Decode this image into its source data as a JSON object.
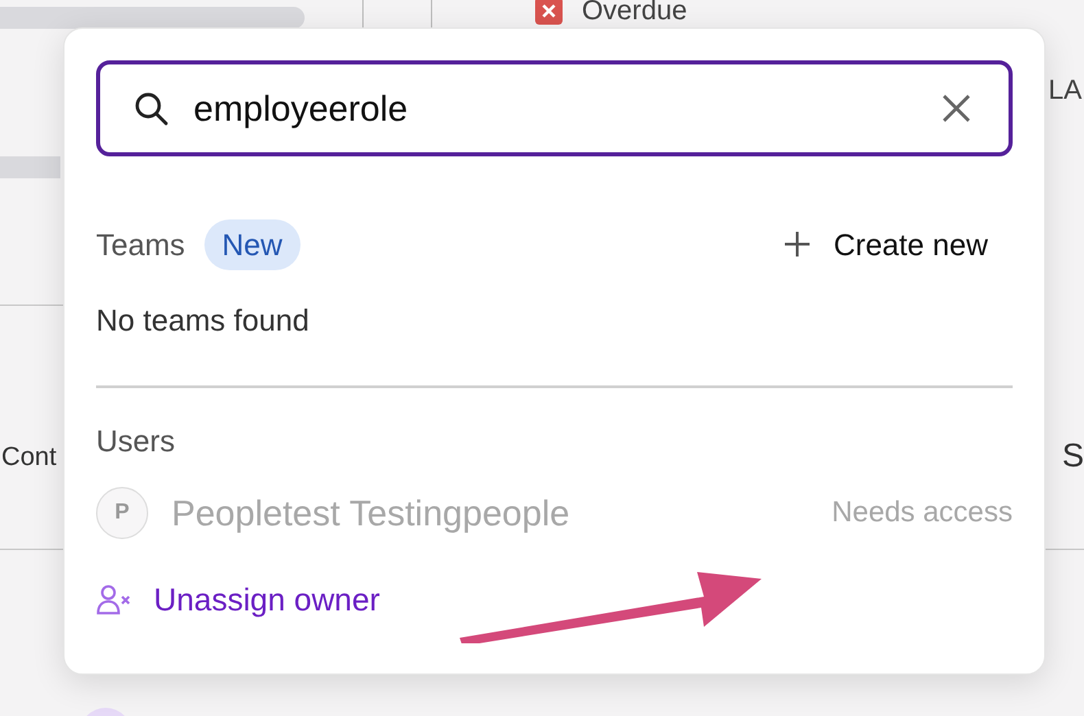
{
  "background": {
    "status_label": "Overdue",
    "left_label": "Cont",
    "right_labels": [
      "LA",
      "S"
    ]
  },
  "popover": {
    "search": {
      "value": "employeerole"
    },
    "teams": {
      "heading": "Teams",
      "badge": "New",
      "create_button": "Create new",
      "empty_message": "No teams found"
    },
    "users": {
      "heading": "Users",
      "items": [
        {
          "initial": "P",
          "name": "Peopletest Testingpeople",
          "status": "Needs access",
          "disabled": true
        }
      ]
    },
    "unassign_button": "Unassign owner"
  }
}
